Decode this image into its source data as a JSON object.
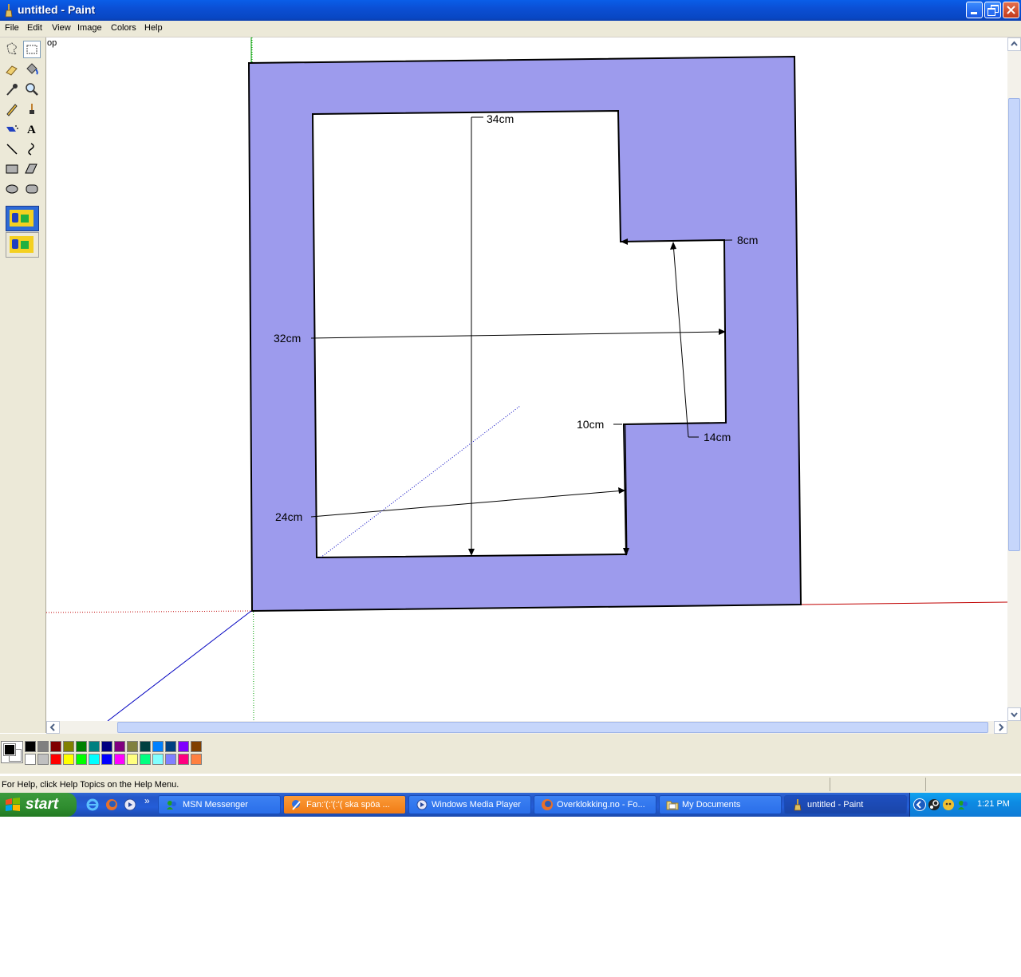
{
  "window": {
    "title": "untitled - Paint"
  },
  "menu": [
    "File",
    "Edit",
    "View",
    "Image",
    "Colors",
    "Help"
  ],
  "tools": [
    "free-select",
    "rect-select",
    "eraser",
    "fill",
    "color-picker",
    "magnifier",
    "pencil",
    "brush",
    "airbrush",
    "text",
    "line",
    "curve",
    "rectangle",
    "polygon",
    "ellipse",
    "rounded-rectangle"
  ],
  "canvas": {
    "corner_text": "op",
    "labels": {
      "l34": "34cm",
      "l8": "8cm",
      "l32": "32cm",
      "l10": "10cm",
      "l14": "14cm",
      "l24": "24cm"
    },
    "fill_color": "#9d9bed"
  },
  "palette": {
    "foreground": "#000000",
    "background": "#ffffff",
    "row1": [
      "#000000",
      "#808080",
      "#800000",
      "#808000",
      "#008000",
      "#008080",
      "#000080",
      "#800080",
      "#808040",
      "#004040",
      "#0080ff",
      "#004080",
      "#8000ff",
      "#804000"
    ],
    "row2": [
      "#ffffff",
      "#c0c0c0",
      "#ff0000",
      "#ffff00",
      "#00ff00",
      "#00ffff",
      "#0000ff",
      "#ff00ff",
      "#ffff80",
      "#00ff80",
      "#80ffff",
      "#8080ff",
      "#ff0080",
      "#ff8040"
    ]
  },
  "status": {
    "help_text": "For Help, click Help Topics on the Help Menu."
  },
  "taskbar": {
    "start_label": "start",
    "tasks": [
      {
        "label": "MSN Messenger"
      },
      {
        "label": "Fan:'(:'(:'( ska spöa ..."
      },
      {
        "label": "Windows Media Player"
      },
      {
        "label": "Overklokking.no - Fo..."
      },
      {
        "label": "My Documents"
      },
      {
        "label": "untitled - Paint"
      }
    ],
    "clock": "1:21 PM"
  }
}
